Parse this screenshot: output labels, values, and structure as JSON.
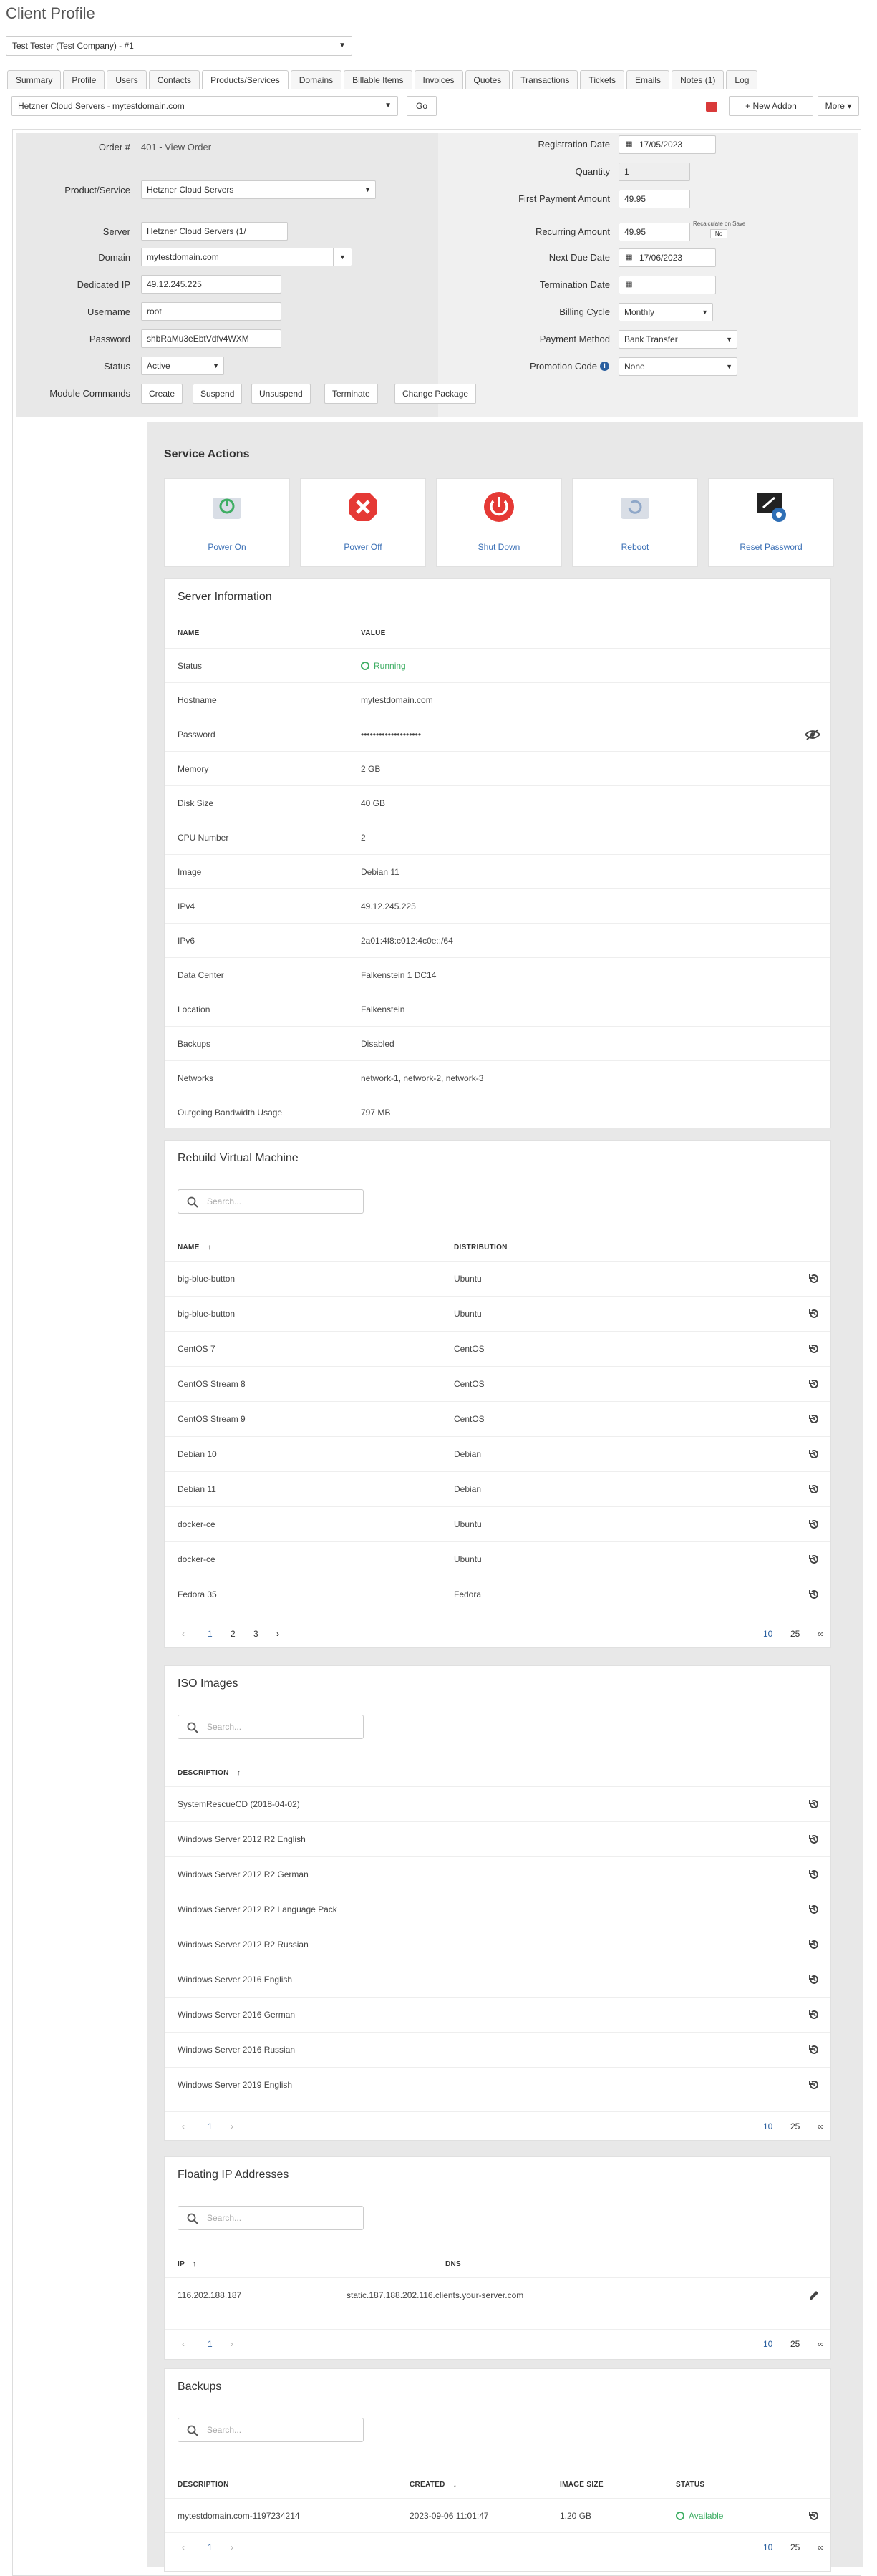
{
  "page_title": "Client Profile",
  "client_select": "Test Tester (Test Company) - #1",
  "tabs": [
    "Summary",
    "Profile",
    "Users",
    "Contacts",
    "Products/Services",
    "Domains",
    "Billable Items",
    "Invoices",
    "Quotes",
    "Transactions",
    "Tickets",
    "Emails",
    "Notes (1)",
    "Log"
  ],
  "service_select": "Hetzner Cloud Servers - mytestdomain.com",
  "go_label": "Go",
  "new_addon_label": "+ New Addon",
  "more_label": "More ▾",
  "form": {
    "order_label": "Order #",
    "order_value": "401 - View Order",
    "product_label": "Product/Service",
    "product_value": "Hetzner Cloud Servers",
    "server_label": "Server",
    "server_value": "Hetzner Cloud Servers (1/",
    "domain_label": "Domain",
    "domain_value": "mytestdomain.com",
    "dedicated_ip_label": "Dedicated IP",
    "dedicated_ip_value": "49.12.245.225",
    "username_label": "Username",
    "username_value": "root",
    "password_label": "Password",
    "password_value": "shbRaMu3eEbtVdfv4WXM",
    "status_label": "Status",
    "status_value": "Active",
    "module_commands_label": "Module Commands",
    "module_buttons": [
      "Create",
      "Suspend",
      "Unsuspend",
      "Terminate",
      "Change Package"
    ],
    "reg_date_label": "Registration Date",
    "reg_date_value": "17/05/2023",
    "quantity_label": "Quantity",
    "quantity_value": "1",
    "first_payment_label": "First Payment Amount",
    "first_payment_value": "49.95",
    "recurring_label": "Recurring Amount",
    "recurring_value": "49.95",
    "recalc_label": "Recalculate on Save",
    "recalc_no": "No",
    "next_due_label": "Next Due Date",
    "next_due_value": "17/06/2023",
    "termination_label": "Termination Date",
    "termination_value": "",
    "billing_cycle_label": "Billing Cycle",
    "billing_cycle_value": "Monthly",
    "payment_method_label": "Payment Method",
    "payment_method_value": "Bank Transfer",
    "promo_label": "Promotion Code",
    "promo_value": "None"
  },
  "service_actions": {
    "title": "Service Actions",
    "items": [
      {
        "label": "Power On",
        "icon": "power-on-icon",
        "color": "#3fae64"
      },
      {
        "label": "Power Off",
        "icon": "power-off-icon",
        "color": "#e53935"
      },
      {
        "label": "Shut Down",
        "icon": "shutdown-icon",
        "color": "#e53935"
      },
      {
        "label": "Reboot",
        "icon": "reboot-icon",
        "color": "#8fa7c8"
      },
      {
        "label": "Reset Password",
        "icon": "reset-password-icon",
        "color": "#2f6fb6"
      }
    ]
  },
  "server_info": {
    "title": "Server Information",
    "col_name": "NAME",
    "col_value": "VALUE",
    "rows": [
      [
        "Status",
        "Running"
      ],
      [
        "Hostname",
        "mytestdomain.com"
      ],
      [
        "Password",
        "••••••••••••••••••••"
      ],
      [
        "Memory",
        "2 GB"
      ],
      [
        "Disk Size",
        "40 GB"
      ],
      [
        "CPU Number",
        "2"
      ],
      [
        "Image",
        "Debian 11"
      ],
      [
        "IPv4",
        "49.12.245.225"
      ],
      [
        "IPv6",
        "2a01:4f8:c012:4c0e::/64"
      ],
      [
        "Data Center",
        "Falkenstein 1 DC14"
      ],
      [
        "Location",
        "Falkenstein"
      ],
      [
        "Backups",
        "Disabled"
      ],
      [
        "Networks",
        "network-1, network-2, network-3"
      ],
      [
        "Outgoing Bandwidth Usage",
        "797 MB"
      ]
    ]
  },
  "rebuild": {
    "title": "Rebuild Virtual Machine",
    "search_placeholder": "Search...",
    "col_name": "NAME",
    "col_dist": "DISTRIBUTION",
    "rows": [
      [
        "big-blue-button",
        "Ubuntu"
      ],
      [
        "big-blue-button",
        "Ubuntu"
      ],
      [
        "CentOS 7",
        "CentOS"
      ],
      [
        "CentOS Stream 8",
        "CentOS"
      ],
      [
        "CentOS Stream 9",
        "CentOS"
      ],
      [
        "Debian 10",
        "Debian"
      ],
      [
        "Debian 11",
        "Debian"
      ],
      [
        "docker-ce",
        "Ubuntu"
      ],
      [
        "docker-ce",
        "Ubuntu"
      ],
      [
        "Fedora 35",
        "Fedora"
      ]
    ],
    "pages": [
      "1",
      "2",
      "3"
    ],
    "page_sizes": [
      "10",
      "25",
      "∞"
    ]
  },
  "iso": {
    "title": "ISO Images",
    "search_placeholder": "Search...",
    "col_desc": "DESCRIPTION",
    "rows": [
      "SystemRescueCD (2018-04-02)",
      "Windows Server 2012 R2 English",
      "Windows Server 2012 R2 German",
      "Windows Server 2012 R2 Language Pack",
      "Windows Server 2012 R2 Russian",
      "Windows Server 2016 English",
      "Windows Server 2016 German",
      "Windows Server 2016 Russian",
      "Windows Server 2019 English"
    ],
    "pages": [
      "1"
    ],
    "page_sizes": [
      "10",
      "25",
      "∞"
    ]
  },
  "floating": {
    "title": "Floating IP Addresses",
    "search_placeholder": "Search...",
    "col_ip": "IP",
    "col_dns": "DNS",
    "rows": [
      [
        "116.202.188.187",
        "static.187.188.202.116.clients.your-server.com"
      ]
    ],
    "pages": [
      "1"
    ],
    "page_sizes": [
      "10",
      "25",
      "∞"
    ]
  },
  "backups": {
    "title": "Backups",
    "search_placeholder": "Search...",
    "col_desc": "DESCRIPTION",
    "col_created": "CREATED",
    "col_size": "IMAGE SIZE",
    "col_status": "STATUS",
    "rows": [
      [
        "mytestdomain.com-1197234214",
        "2023-09-06 11:01:47",
        "1.20 GB",
        "Available"
      ]
    ],
    "pages": [
      "1"
    ],
    "page_sizes": [
      "10",
      "25",
      "∞"
    ]
  }
}
